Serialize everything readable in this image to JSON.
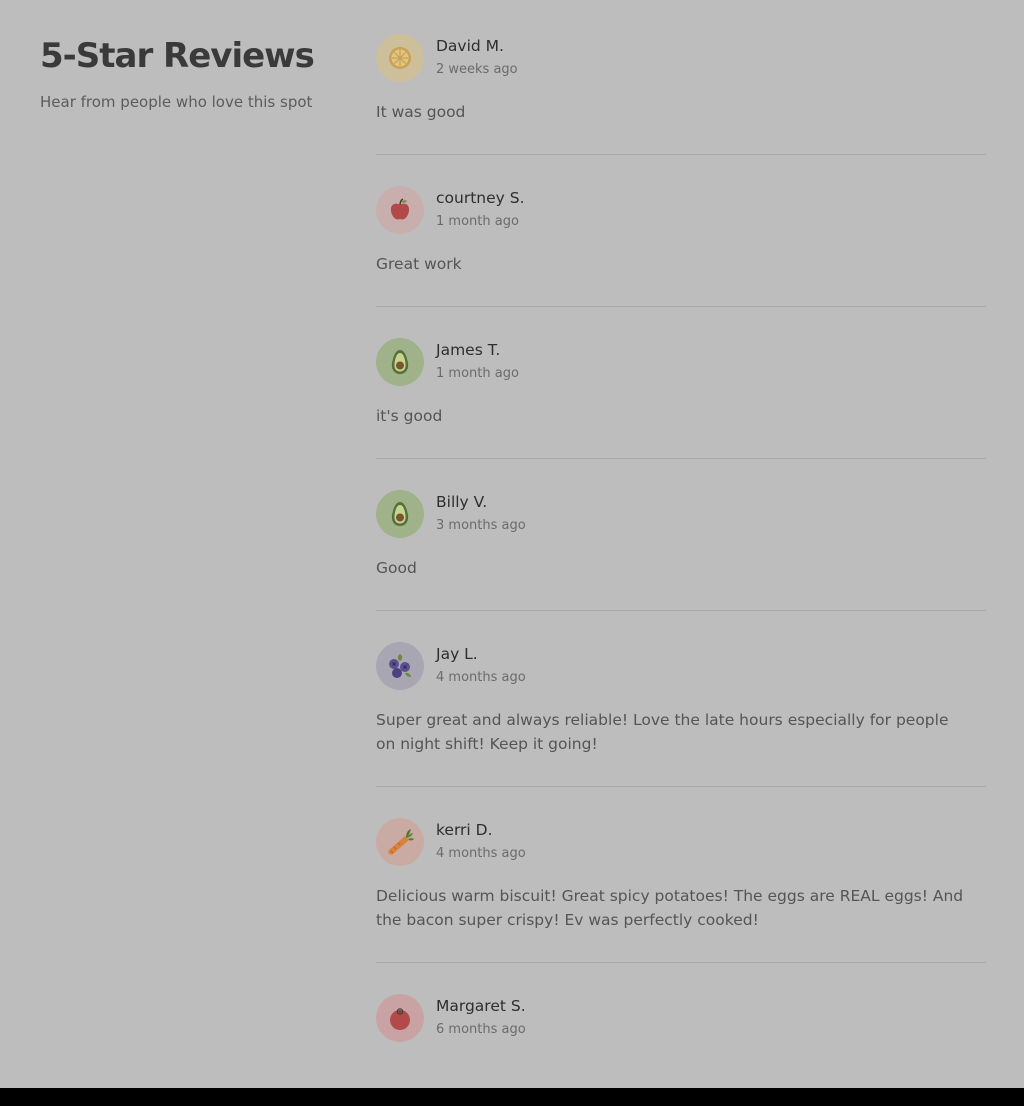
{
  "header": {
    "title": "5-Star Reviews",
    "subtitle": "Hear from people who love this spot"
  },
  "reviews": [
    {
      "name": "David M.",
      "date": "2 weeks ago",
      "text": "It was good",
      "avatar_icon": "lemon-icon",
      "avatar_bg": "#cdbf9a"
    },
    {
      "name": "courtney S.",
      "date": "1 month ago",
      "text": "Great work",
      "avatar_icon": "apple-icon",
      "avatar_bg": "#c9aeae"
    },
    {
      "name": "James T.",
      "date": "1 month ago",
      "text": "it's good",
      "avatar_icon": "avocado-icon",
      "avatar_bg": "#9fb28a"
    },
    {
      "name": "Billy V.",
      "date": "3 months ago",
      "text": "Good",
      "avatar_icon": "avocado-icon",
      "avatar_bg": "#9fb28a"
    },
    {
      "name": "Jay L.",
      "date": "4 months ago",
      "text": "Super great and always reliable! Love the late hours especially for people on night shift! Keep it going!",
      "avatar_icon": "blueberries-icon",
      "avatar_bg": "#a9a6b3"
    },
    {
      "name": "kerri D.",
      "date": "4 months ago",
      "text": "Delicious warm biscuit! Great spicy potatoes! The eggs are REAL eggs! And the bacon super crispy! Ev was perfectly cooked!",
      "avatar_icon": "carrot-icon",
      "avatar_bg": "#caaba3"
    },
    {
      "name": "Margaret S.",
      "date": "6 months ago",
      "text": "",
      "avatar_icon": "tomato-icon",
      "avatar_bg": "#c9a3a3"
    }
  ]
}
